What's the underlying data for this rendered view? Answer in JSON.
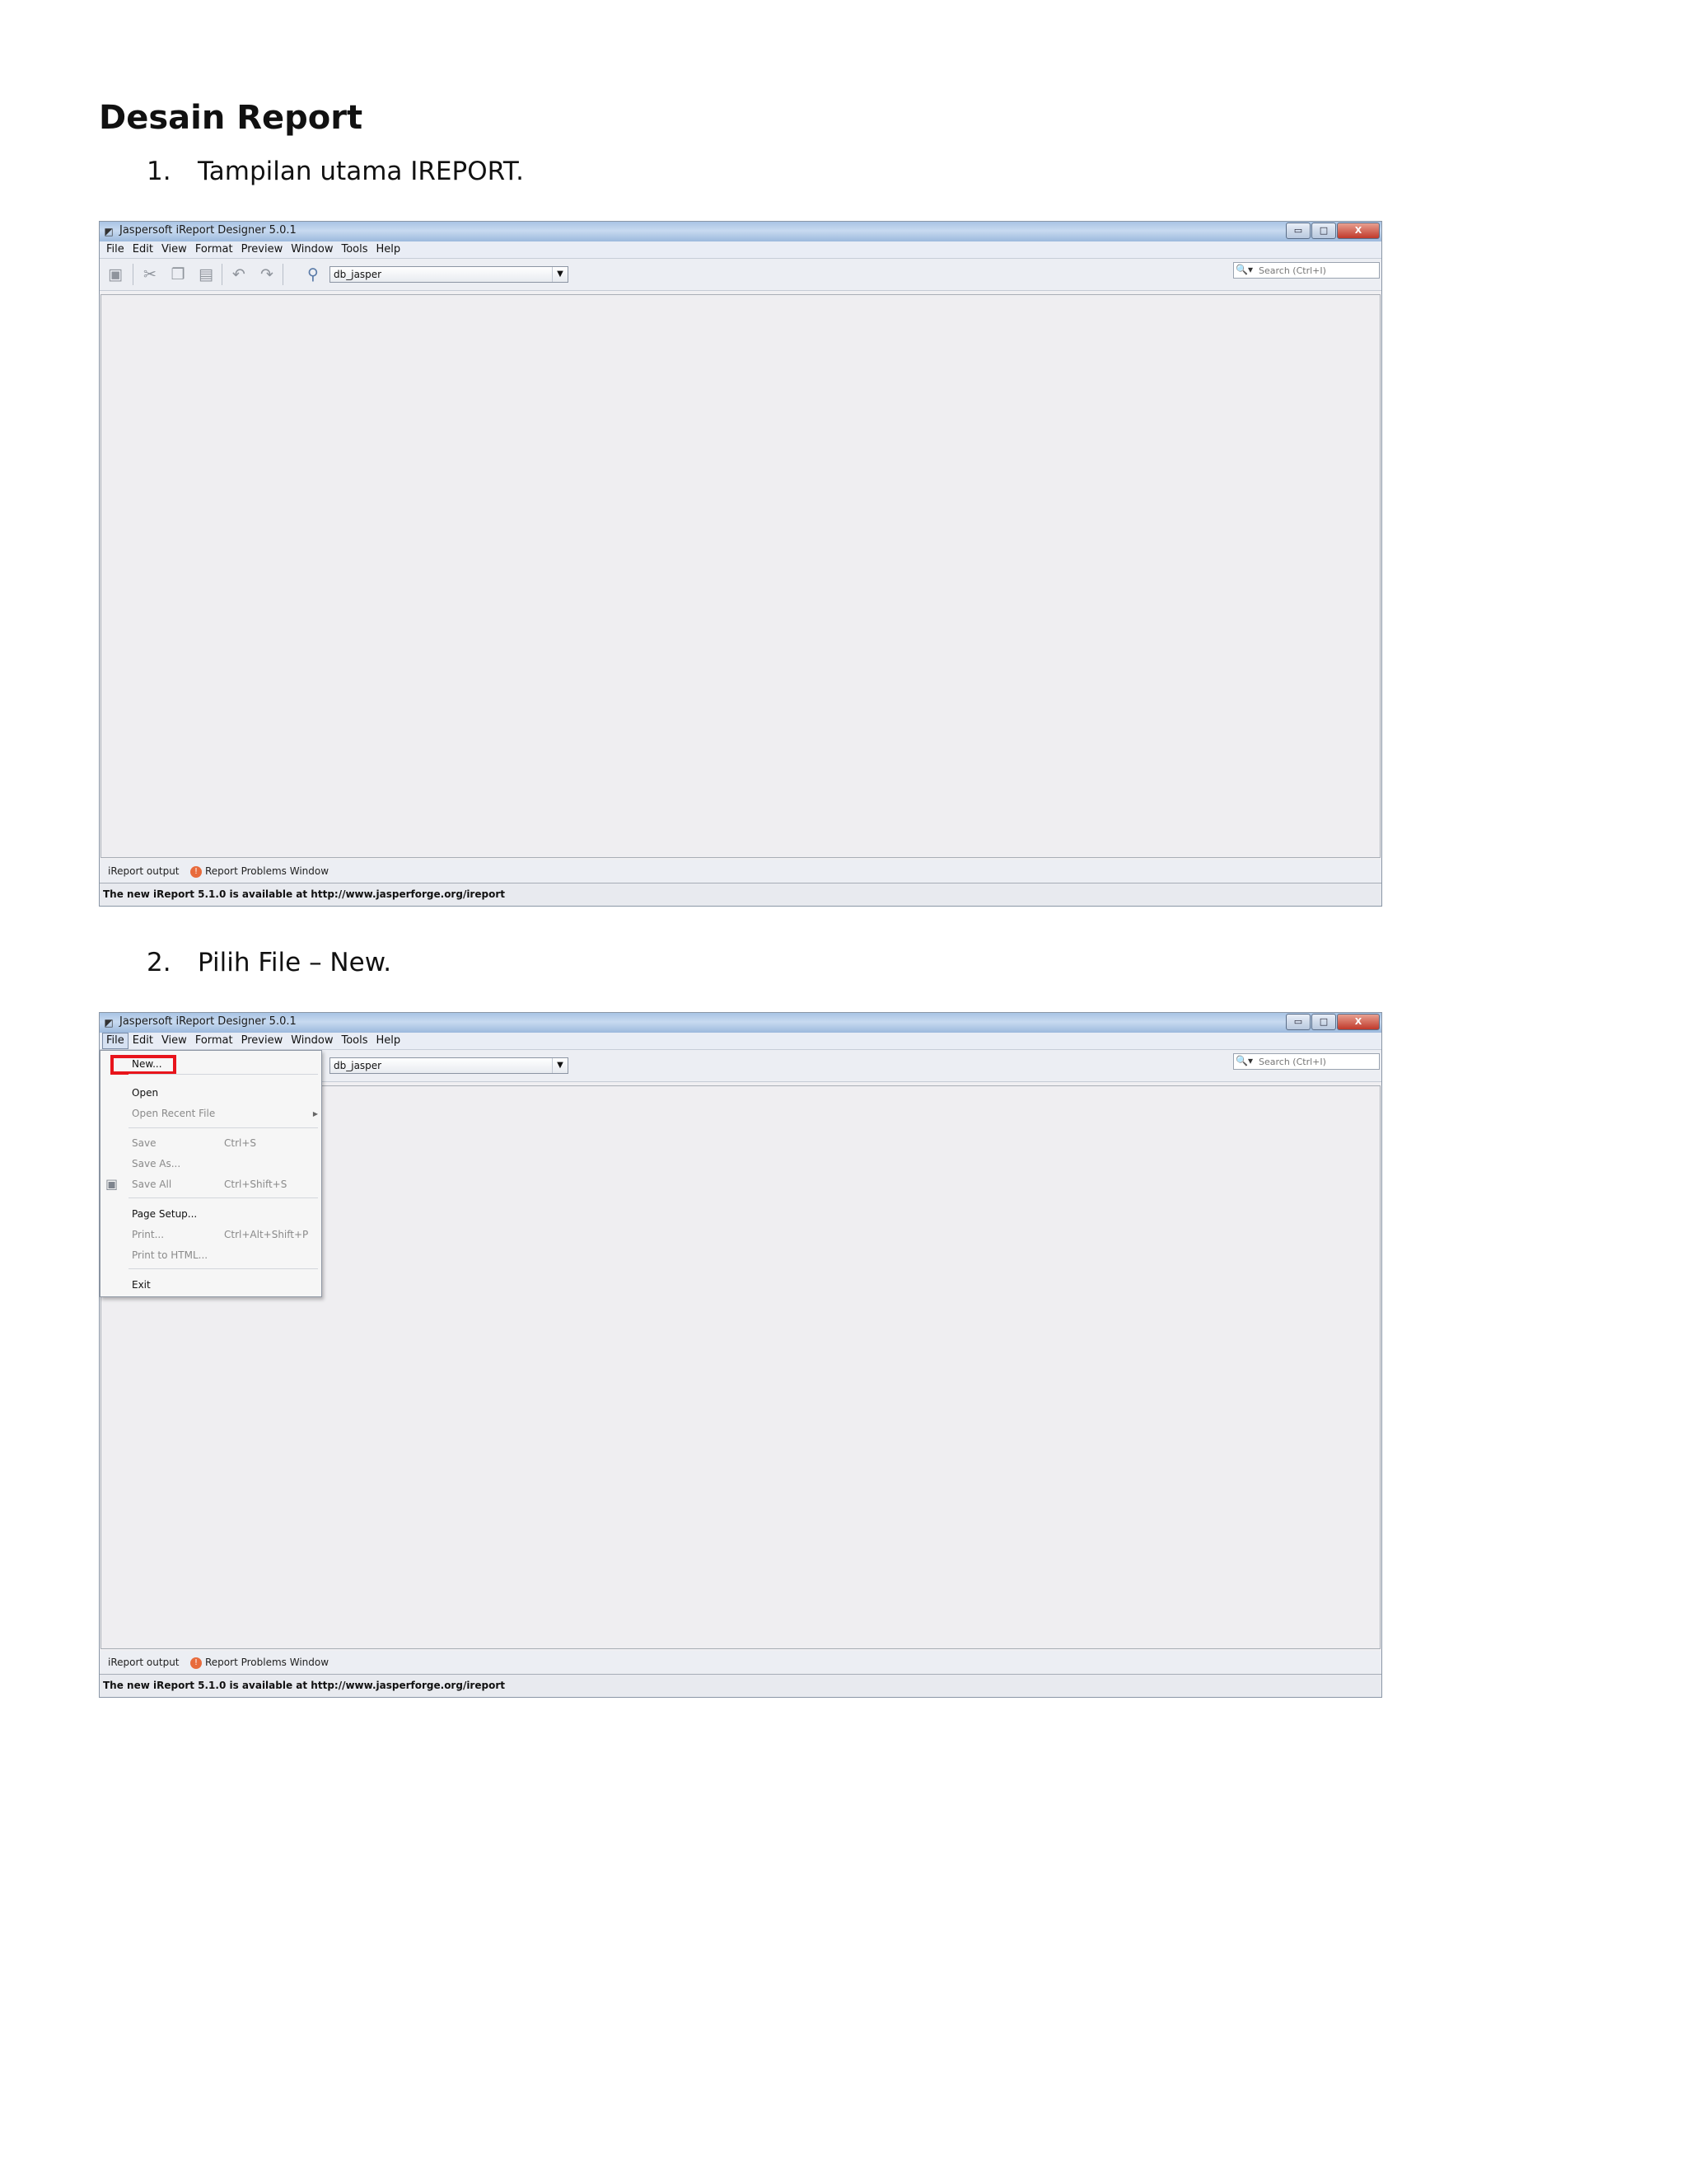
{
  "document": {
    "title": "Desain Report",
    "steps": [
      {
        "number": "1.",
        "text": "Tampilan utama IREPORT."
      },
      {
        "number": "2.",
        "text": "Pilih File – New."
      }
    ]
  },
  "app": {
    "window_title": "Jaspersoft iReport Designer 5.0.1",
    "window_buttons": {
      "minimize": "▭",
      "maximize": "□",
      "close": "X"
    },
    "menus": [
      "File",
      "Edit",
      "View",
      "Format",
      "Preview",
      "Window",
      "Tools",
      "Help"
    ],
    "toolbar": {
      "icons": [
        "save-all-icon",
        "cut-icon",
        "copy-icon",
        "paste-icon",
        "undo-icon",
        "redo-icon",
        "datasource-icon"
      ],
      "datasource_value": "db_jasper",
      "search_placeholder": "Search (Ctrl+I)"
    },
    "output_tabs": [
      {
        "label": "iReport output"
      },
      {
        "label": "Report Problems Window"
      }
    ],
    "status_text": "The new iReport 5.1.0 is available at http://www.jasperforge.org/ireport"
  },
  "file_menu": {
    "items": [
      {
        "label": "New...",
        "shortcut": "",
        "enabled": true
      },
      {
        "label": "Open",
        "shortcut": "",
        "enabled": true
      },
      {
        "label": "Open Recent File",
        "shortcut": "",
        "enabled": false
      },
      {
        "label": "Save",
        "shortcut": "Ctrl+S",
        "enabled": false
      },
      {
        "label": "Save As...",
        "shortcut": "",
        "enabled": false
      },
      {
        "label": "Save All",
        "shortcut": "Ctrl+Shift+S",
        "enabled": false
      },
      {
        "label": "Page Setup...",
        "shortcut": "",
        "enabled": true
      },
      {
        "label": "Print...",
        "shortcut": "Ctrl+Alt+Shift+P",
        "enabled": false
      },
      {
        "label": "Print to HTML...",
        "shortcut": "",
        "enabled": false
      },
      {
        "label": "Exit",
        "shortcut": "",
        "enabled": true
      }
    ],
    "highlight_color": "#e8141b"
  }
}
